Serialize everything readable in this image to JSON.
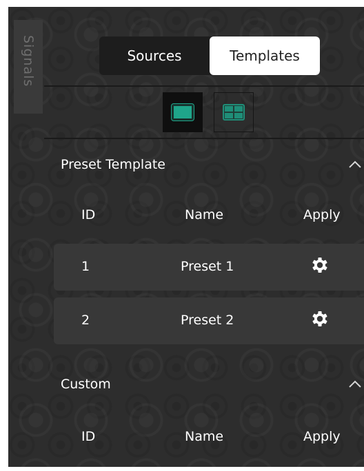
{
  "side_tab": {
    "label": "Signals"
  },
  "mode_toggle": {
    "sources_label": "Sources",
    "templates_label": "Templates",
    "selected": "Templates"
  },
  "view_toggle": {
    "options": [
      "single-view-icon",
      "quad-view-icon"
    ],
    "selected": "single-view-icon"
  },
  "colors": {
    "accent": "#1fa58a",
    "panel": "#2d2d2d",
    "row": "#383838"
  },
  "preset_section": {
    "title": "Preset Template",
    "columns": {
      "id": "ID",
      "name": "Name",
      "apply": "Apply"
    },
    "rows": [
      {
        "id": "1",
        "name": "Preset 1",
        "apply_icon": "gear-icon"
      },
      {
        "id": "2",
        "name": "Preset 2",
        "apply_icon": "gear-icon"
      }
    ],
    "collapse_icon": "chevron-up-icon"
  },
  "custom_section": {
    "title": "Custom",
    "columns": {
      "id": "ID",
      "name": "Name",
      "apply": "Apply"
    },
    "collapse_icon": "chevron-up-icon"
  }
}
